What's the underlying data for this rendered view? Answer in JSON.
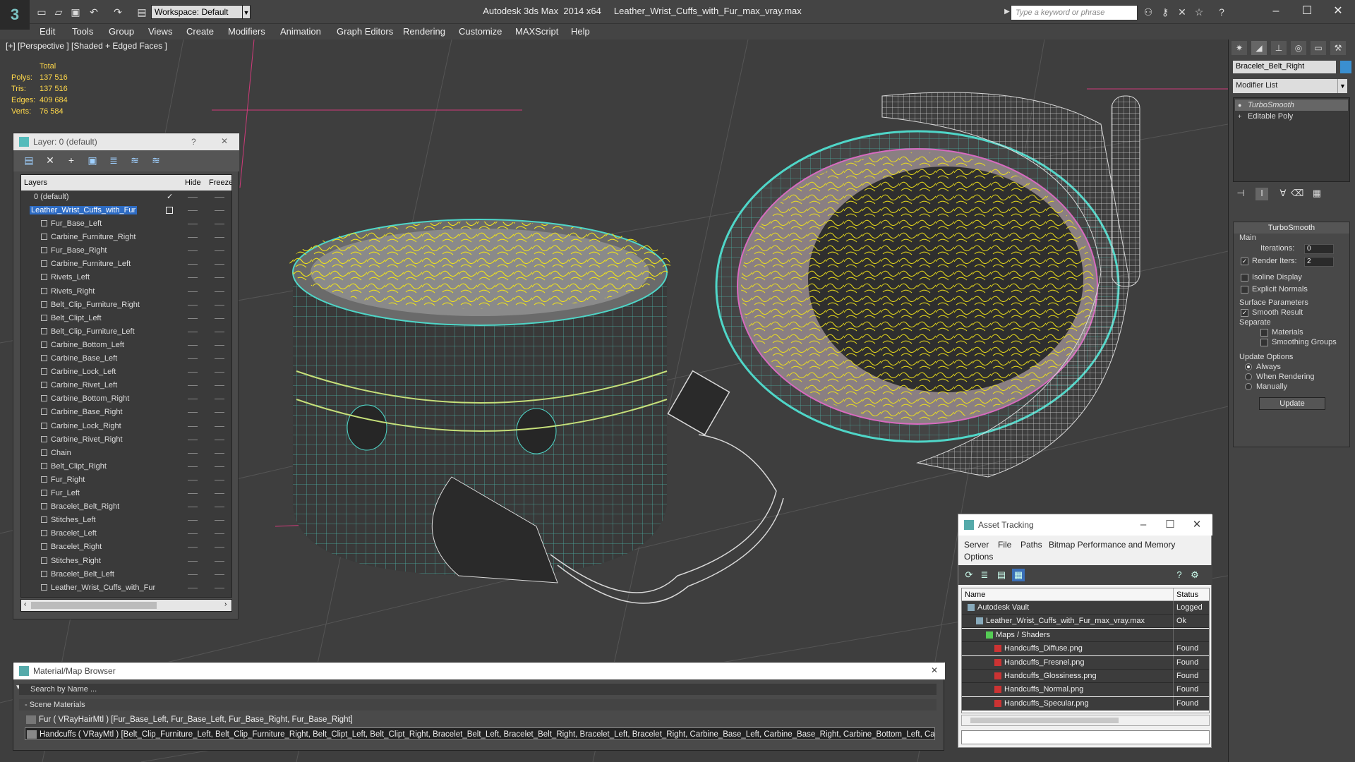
{
  "app": {
    "window_title": "Autodesk 3ds Max  2014 x64     Leather_Wrist_Cuffs_with_Fur_max_vray.max",
    "workspace": "Workspace: Default",
    "search_placeholder": "Type a keyword or phrase",
    "logo": "3"
  },
  "menu": [
    "Edit",
    "Tools",
    "Group",
    "Views",
    "Create",
    "Modifiers",
    "Animation",
    "Graph Editors",
    "Rendering",
    "Customize",
    "MAXScript",
    "Help"
  ],
  "viewport": {
    "label": "[+] [Perspective ] [Shaded + Edged Faces ]",
    "stats": {
      "header": "Total",
      "rows": [
        {
          "k": "Polys:",
          "v": "137 516"
        },
        {
          "k": "Tris:",
          "v": "137 516"
        },
        {
          "k": "Edges:",
          "v": "409 684"
        },
        {
          "k": "Verts:",
          "v": "76 584"
        }
      ]
    }
  },
  "layers": {
    "title": "Layer: 0 (default)",
    "help": "?",
    "close": "✕",
    "col_layers": "Layers",
    "col_hide": "Hide",
    "col_freeze": "Freeze",
    "default_layer": "0 (default)",
    "parent_layer": "Leather_Wrist_Cuffs_with_Fur",
    "items": [
      "Fur_Base_Left",
      "Carbine_Furniture_Right",
      "Fur_Base_Right",
      "Carbine_Furniture_Left",
      "Rivets_Left",
      "Rivets_Right",
      "Belt_Clip_Furniture_Right",
      "Belt_Clipt_Left",
      "Belt_Clip_Furniture_Left",
      "Carbine_Bottom_Left",
      "Carbine_Base_Left",
      "Carbine_Lock_Left",
      "Carbine_Rivet_Left",
      "Carbine_Bottom_Right",
      "Carbine_Base_Right",
      "Carbine_Lock_Right",
      "Carbine_Rivet_Right",
      "Chain",
      "Belt_Clipt_Right",
      "Fur_Right",
      "Fur_Left",
      "Bracelet_Belt_Right",
      "Stitches_Left",
      "Bracelet_Left",
      "Bracelet_Right",
      "Stitches_Right",
      "Bracelet_Belt_Left",
      "Leather_Wrist_Cuffs_with_Fur"
    ]
  },
  "command_panel": {
    "object_name": "Bracelet_Belt_Right",
    "object_color": "#3a8fd0",
    "modifier_list": "Modifier List",
    "stack": [
      "TurboSmooth",
      "Editable Poly"
    ],
    "turbosmooth": {
      "title": "TurboSmooth",
      "main": "Main",
      "iterations_label": "Iterations:",
      "iterations": "0",
      "render_iters_label": "Render Iters:",
      "render_iters": "2",
      "isoline": "Isoline Display",
      "explicit_normals": "Explicit Normals",
      "surface_params": "Surface Parameters",
      "smooth_result": "Smooth Result",
      "separate": "Separate",
      "materials": "Materials",
      "smoothing_groups": "Smoothing Groups",
      "update_options": "Update Options",
      "always": "Always",
      "when_rendering": "When Rendering",
      "manually": "Manually",
      "update": "Update"
    }
  },
  "asset_tracking": {
    "title": "Asset Tracking",
    "menu": [
      "Server",
      "File",
      "Paths",
      "Bitmap Performance and Memory"
    ],
    "options": "Options",
    "col_name": "Name",
    "col_status": "Status",
    "rows": [
      {
        "name": "Autodesk Vault",
        "status": "Logged"
      },
      {
        "name": "Leather_Wrist_Cuffs_with_Fur_max_vray.max",
        "status": "Ok"
      },
      {
        "name": "Maps / Shaders",
        "status": ""
      },
      {
        "name": "Handcuffs_Diffuse.png",
        "status": "Found"
      },
      {
        "name": "Handcuffs_Fresnel.png",
        "status": "Found"
      },
      {
        "name": "Handcuffs_Glossiness.png",
        "status": "Found"
      },
      {
        "name": "Handcuffs_Normal.png",
        "status": "Found"
      },
      {
        "name": "Handcuffs_Specular.png",
        "status": "Found"
      }
    ]
  },
  "material_browser": {
    "title": "Material/Map Browser",
    "search_placeholder": "Search by Name ...",
    "group": "- Scene Materials",
    "rows": [
      "Fur  ( VRayHairMtl ) [Fur_Base_Left, Fur_Base_Left, Fur_Base_Right, Fur_Base_Right]",
      "Handcuffs  ( VRayMtl ) [Belt_Clip_Furniture_Left, Belt_Clip_Furniture_Right, Belt_Clipt_Left, Belt_Clipt_Right, Bracelet_Belt_Left, Bracelet_Belt_Right, Bracelet_Left, Bracelet_Right, Carbine_Base_Left, Carbine_Base_Right, Carbine_Bottom_Left, Carbi..."
    ]
  },
  "colors": {
    "fur": "#f0e21a",
    "wire": "#4fd6c8",
    "selection": "#2e6cc4"
  }
}
